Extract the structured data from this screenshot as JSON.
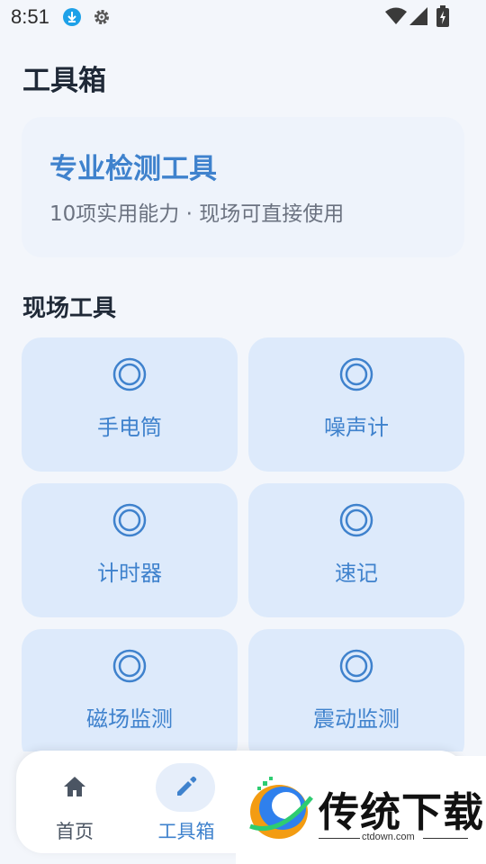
{
  "status_bar": {
    "time": "8:51",
    "icons": [
      "download-icon",
      "gear-icon",
      "wifi-icon",
      "signal-icon",
      "battery-icon"
    ]
  },
  "page": {
    "title": "工具箱"
  },
  "hero": {
    "title": "专业检测工具",
    "subtitle": "10项实用能力 · 现场可直接使用"
  },
  "section": {
    "title": "现场工具"
  },
  "tools": [
    {
      "label": "手电筒",
      "icon": "ring-icon"
    },
    {
      "label": "噪声计",
      "icon": "ring-icon"
    },
    {
      "label": "计时器",
      "icon": "ring-icon"
    },
    {
      "label": "速记",
      "icon": "ring-icon"
    },
    {
      "label": "磁场监测",
      "icon": "ring-icon"
    },
    {
      "label": "震动监测",
      "icon": "ring-icon"
    }
  ],
  "nav": {
    "items": [
      {
        "label": "首页",
        "icon": "home-icon",
        "active": false
      },
      {
        "label": "工具箱",
        "icon": "pencil-icon",
        "active": true
      }
    ]
  },
  "watermark": {
    "text": "传统下载",
    "url": "ctdown.com"
  },
  "colors": {
    "accent": "#3f82cd",
    "background": "#f3f6fb",
    "hero_card": "#eef3fb",
    "tile": "#ddeafb",
    "nav_active_pill": "#e6eefa"
  }
}
